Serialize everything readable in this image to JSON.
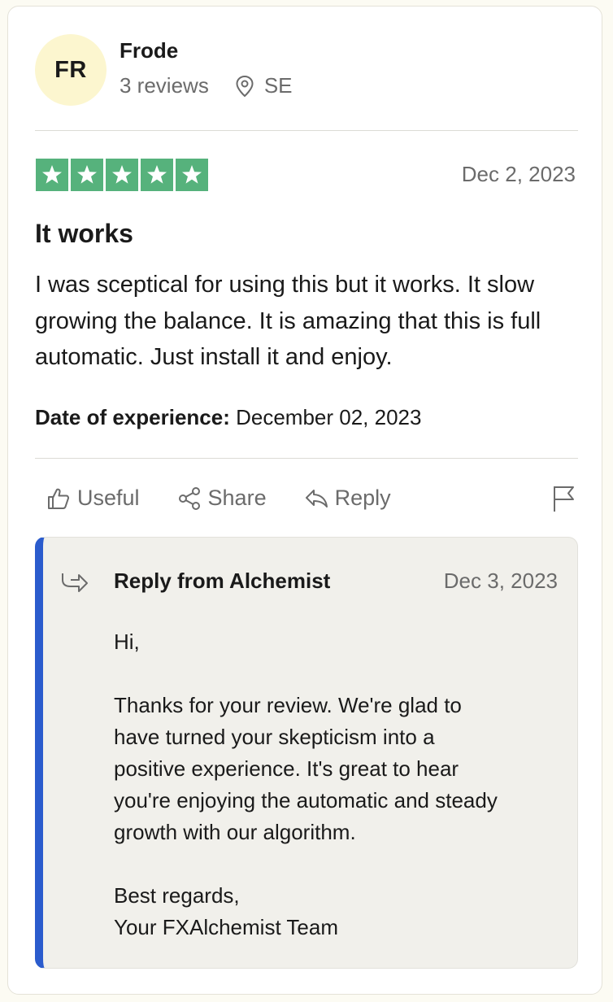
{
  "reviewer": {
    "initials": "FR",
    "name": "Frode",
    "reviews_count": "3 reviews",
    "country": "SE"
  },
  "review": {
    "rating": 5,
    "max_rating": 5,
    "date": "Dec 2, 2023",
    "title": "It works",
    "body": "I was sceptical for using this but it works. It slow growing the balance. It is amazing that this is full automatic. Just install it and enjoy.",
    "experience_label": "Date of experience:",
    "experience_date": "December 02, 2023"
  },
  "actions": {
    "useful_label": "Useful",
    "share_label": "Share",
    "reply_label": "Reply"
  },
  "reply": {
    "from_label": "Reply from Alchemist",
    "date": "Dec 3, 2023",
    "greeting": "Hi,",
    "line1": "Thanks for your review. We're glad to",
    "line2": "have turned your skepticism into a",
    "line3": "positive experience. It's great to hear",
    "line4": "you're enjoying the automatic and steady",
    "line5": "growth with our algorithm.",
    "signoff1": "Best regards,",
    "signoff2": "Your FXAlchemist Team"
  },
  "colors": {
    "star_green": "#56b27c",
    "reply_accent": "#2b5ccd",
    "avatar_bg": "#fcf6cf"
  },
  "icons": [
    "location-pin-icon",
    "star-icon",
    "thumbs-up-icon",
    "share-icon",
    "reply-arrow-icon",
    "flag-icon",
    "reply-forward-icon"
  ]
}
